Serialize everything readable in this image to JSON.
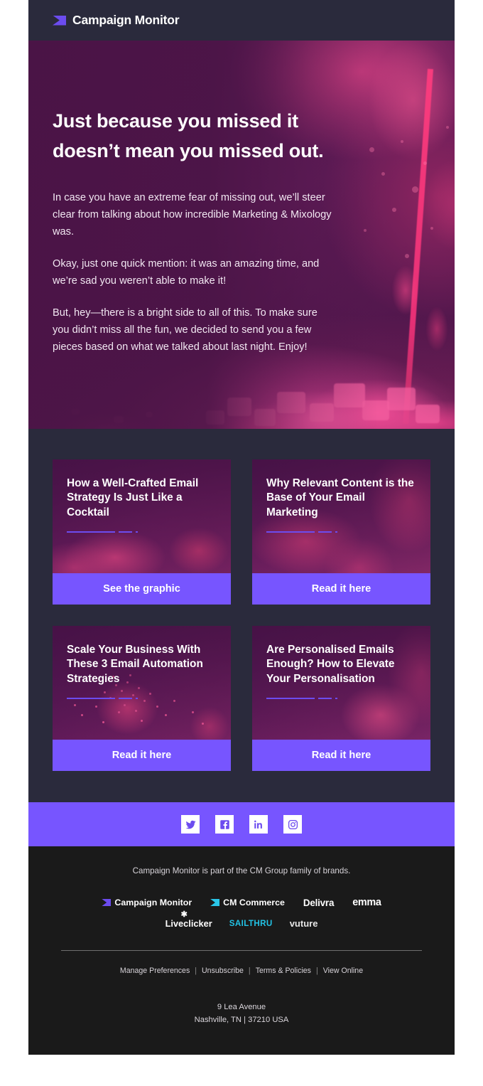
{
  "header": {
    "brand": "Campaign Monitor",
    "logo_icon": "campaign-monitor-envelope-icon",
    "bg_color": "#2A2A3C"
  },
  "hero": {
    "title": "Just because you missed it doesn’t mean you missed out.",
    "paragraphs": [
      "In case you have an extreme fear of missing out, we’ll steer clear from talking about how incredible Marketing & Mixology was.",
      "Okay, just one quick mention: it was an amazing time, and we’re sad you weren’t able to make it!",
      "But, hey—there is a bright side to all of this. To make sure you didn’t miss all the fun, we decided to send you a few pieces based on what we talked about last night. Enjoy!"
    ],
    "bg_color": "#5E1B56"
  },
  "cards": [
    {
      "title": "How a Well-Crafted Email Strategy Is Just Like a Cocktail",
      "cta": "See the graphic",
      "photo": "cocktail-garnish-leaves"
    },
    {
      "title": "Why Relevant Content is the Base of Your Email Marketing",
      "cta": "Read it here",
      "photo": "cocktail-ingredients"
    },
    {
      "title": "Scale Your Business With These 3 Email Automation Strategies",
      "cta": "Read it here",
      "photo": "spice-scatter"
    },
    {
      "title": "Are Personalised Emails Enough? How to Elevate Your Personalisation",
      "cta": "Read it here",
      "photo": "bar-spoon"
    }
  ],
  "social": {
    "bg_color": "#7755FF",
    "items": [
      {
        "name": "twitter",
        "icon": "twitter-icon"
      },
      {
        "name": "facebook",
        "icon": "facebook-icon"
      },
      {
        "name": "linkedin",
        "icon": "linkedin-icon"
      },
      {
        "name": "instagram",
        "icon": "instagram-icon"
      }
    ]
  },
  "footer": {
    "note": "Campaign Monitor is part of the CM Group family of brands.",
    "brands_row1": [
      {
        "label": "Campaign Monitor",
        "mark": "purple-envelope"
      },
      {
        "label": "CM Commerce",
        "mark": "cyan-envelope"
      },
      {
        "label": "Delivra",
        "mark": "none"
      },
      {
        "label": "emma",
        "mark": "none"
      }
    ],
    "brands_row2": [
      {
        "label": "Liveclicker",
        "mark": "starburst"
      },
      {
        "label": "SAILTHRU",
        "mark": "none"
      },
      {
        "label": "vuture",
        "mark": "none"
      }
    ],
    "links": [
      "Manage Preferences",
      "Unsubscribe",
      "Terms & Policies",
      "View Online"
    ],
    "separator": "|",
    "address_line1": "9 Lea Avenue",
    "address_line2": "Nashville, TN | 37210 USA",
    "bg_color": "#1A1A1A"
  }
}
